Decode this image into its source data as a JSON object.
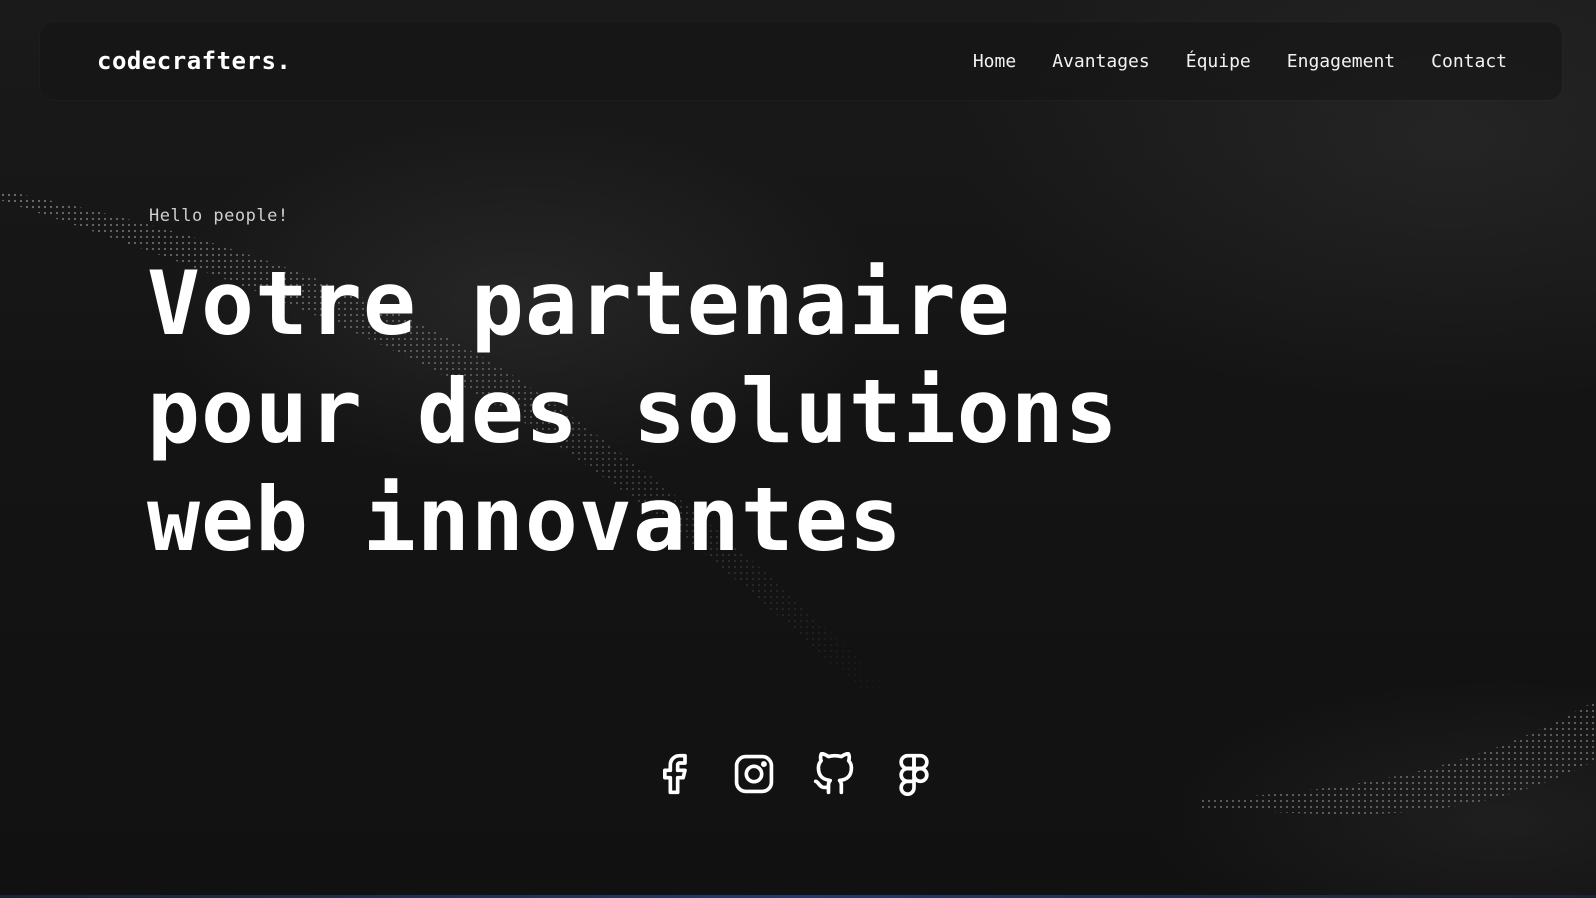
{
  "header": {
    "brand": "codecrafters.",
    "nav": [
      {
        "label": "Home"
      },
      {
        "label": "Avantages"
      },
      {
        "label": "Équipe"
      },
      {
        "label": "Engagement"
      },
      {
        "label": "Contact"
      }
    ]
  },
  "hero": {
    "eyebrow": "Hello people!",
    "title": "Votre partenaire pour des solutions web innovantes"
  },
  "social": [
    {
      "icon": "facebook-icon"
    },
    {
      "icon": "instagram-icon"
    },
    {
      "icon": "github-icon"
    },
    {
      "icon": "figma-icon"
    }
  ],
  "colors": {
    "background": "#121212",
    "text": "#ffffff",
    "accent_line": "#243a6a"
  }
}
